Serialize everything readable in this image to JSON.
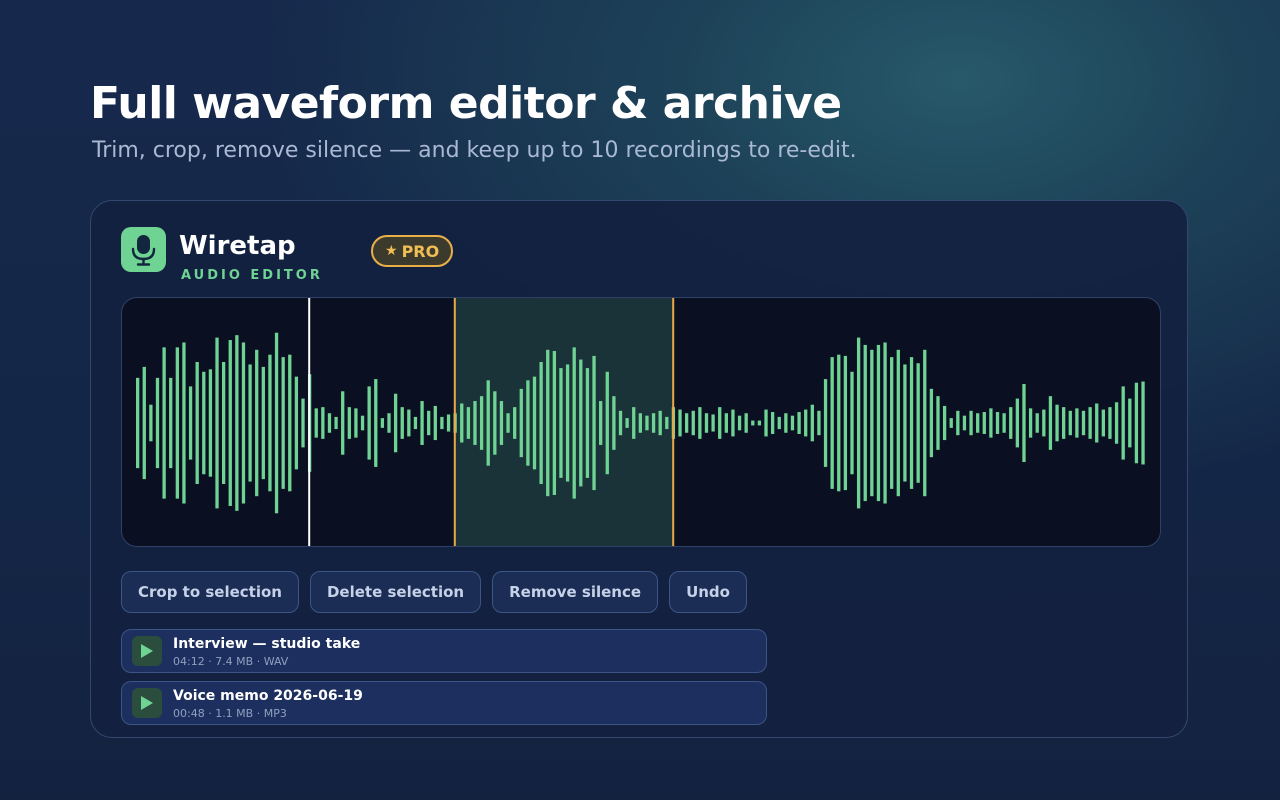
{
  "hero": {
    "title": "Full waveform editor & archive",
    "subtitle": "Trim, crop, remove silence — and keep up to 10 recordings to re-edit."
  },
  "app": {
    "name": "Wiretap",
    "subtitle": "AUDIO EDITOR",
    "icon": "microphone-icon",
    "badge": {
      "icon": "star-icon",
      "label": "PRO"
    }
  },
  "colors": {
    "accent_green": "#6fd394",
    "pro_gold": "#e9b04a",
    "playhead": "#ffffff",
    "selection": "#e9a946"
  },
  "waveform": {
    "playhead_position": 0.18,
    "selection": {
      "start": 0.32,
      "end": 0.53
    },
    "amplitudes": [
      0.37,
      0.46,
      0.15,
      0.37,
      0.62,
      0.37,
      0.62,
      0.66,
      0.3,
      0.5,
      0.42,
      0.44,
      0.7,
      0.5,
      0.68,
      0.72,
      0.66,
      0.48,
      0.6,
      0.46,
      0.56,
      0.74,
      0.54,
      0.56,
      0.38,
      0.2,
      0.4,
      0.12,
      0.13,
      0.08,
      0.05,
      0.26,
      0.13,
      0.12,
      0.06,
      0.3,
      0.36,
      0.04,
      0.08,
      0.24,
      0.13,
      0.11,
      0.05,
      0.18,
      0.1,
      0.14,
      0.05,
      0.07,
      0.08,
      0.16,
      0.13,
      0.18,
      0.22,
      0.35,
      0.26,
      0.18,
      0.08,
      0.13,
      0.28,
      0.35,
      0.38,
      0.5,
      0.6,
      0.59,
      0.45,
      0.48,
      0.62,
      0.52,
      0.45,
      0.55,
      0.18,
      0.42,
      0.22,
      0.1,
      0.04,
      0.13,
      0.08,
      0.06,
      0.08,
      0.1,
      0.05,
      0.13,
      0.11,
      0.08,
      0.1,
      0.13,
      0.08,
      0.07,
      0.13,
      0.08,
      0.11,
      0.06,
      0.08,
      0.02,
      0.02,
      0.11,
      0.09,
      0.05,
      0.08,
      0.06,
      0.09,
      0.11,
      0.15,
      0.1,
      0.36,
      0.54,
      0.56,
      0.55,
      0.42,
      0.7,
      0.64,
      0.6,
      0.64,
      0.66,
      0.54,
      0.6,
      0.48,
      0.54,
      0.49,
      0.6,
      0.28,
      0.22,
      0.14,
      0.04,
      0.1,
      0.06,
      0.1,
      0.08,
      0.09,
      0.12,
      0.09,
      0.08,
      0.13,
      0.2,
      0.32,
      0.12,
      0.08,
      0.11,
      0.22,
      0.15,
      0.13,
      0.1,
      0.12,
      0.1,
      0.13,
      0.16,
      0.11,
      0.13,
      0.17,
      0.3,
      0.2,
      0.33,
      0.34
    ]
  },
  "toolbar": {
    "crop": "Crop to selection",
    "delete": "Delete selection",
    "remove_silence": "Remove silence",
    "undo": "Undo"
  },
  "recordings": [
    {
      "title": "Interview — studio take",
      "meta": "04:12 · 7.4 MB · WAV",
      "icon": "play-icon"
    },
    {
      "title": "Voice memo 2026-06-19",
      "meta": "00:48 · 1.1 MB · MP3",
      "icon": "play-icon"
    }
  ]
}
